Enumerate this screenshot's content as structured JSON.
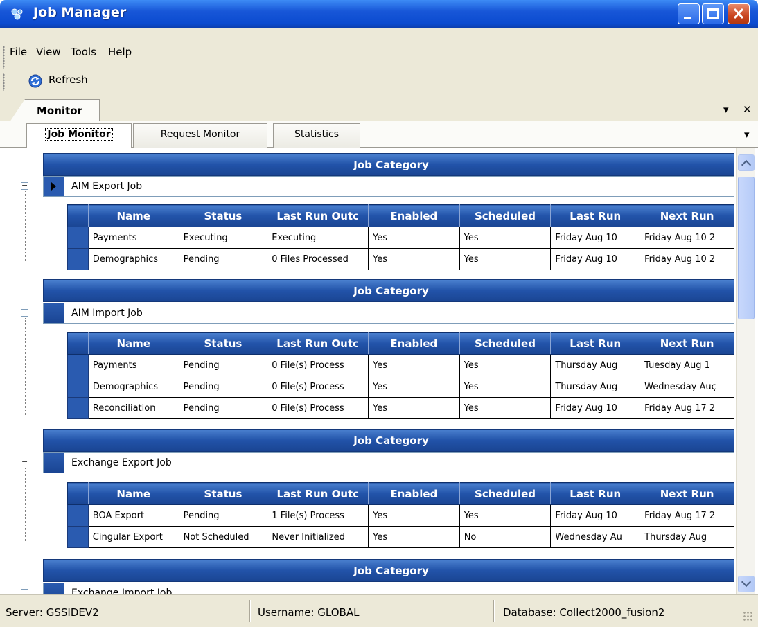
{
  "window": {
    "title": "Job Manager"
  },
  "menu": {
    "file": "File",
    "view": "View",
    "tools": "Tools",
    "help": "Help"
  },
  "toolbar": {
    "refresh": "Refresh"
  },
  "panel": {
    "title": "Monitor",
    "pin": "▾",
    "close": "✕"
  },
  "tabs": [
    {
      "label": "Job Monitor"
    },
    {
      "label": "Request Monitor"
    },
    {
      "label": "Statistics"
    }
  ],
  "tabs_menu": "▾",
  "columns": [
    "Name",
    "Status",
    "Last Run Outc",
    "Enabled",
    "Scheduled",
    "Last Run",
    "Next Run"
  ],
  "categories": [
    {
      "header": "Job Category",
      "name": "AIM Export Job",
      "rows": [
        [
          "Payments",
          "Executing",
          "Executing",
          "Yes",
          "Yes",
          "Friday Aug 10",
          "Friday Aug 10 2"
        ],
        [
          "Demographics",
          "Pending",
          "0 Files Processed",
          "Yes",
          "Yes",
          "Friday Aug 10",
          "Friday Aug 10 2"
        ]
      ]
    },
    {
      "header": "Job Category",
      "name": "AIM Import Job",
      "rows": [
        [
          "Payments",
          "Pending",
          "0 File(s) Process",
          "Yes",
          "Yes",
          "Thursday Aug",
          "Tuesday Aug 1"
        ],
        [
          "Demographics",
          "Pending",
          "0 File(s) Process",
          "Yes",
          "Yes",
          "Thursday Aug",
          "Wednesday Auç"
        ],
        [
          "Reconciliation",
          "Pending",
          "0 File(s) Process",
          "Yes",
          "Yes",
          "Friday Aug 10",
          "Friday Aug 17 2"
        ]
      ]
    },
    {
      "header": "Job Category",
      "name": "Exchange Export Job",
      "rows": [
        [
          "BOA Export",
          "Pending",
          "1 File(s) Process",
          "Yes",
          "Yes",
          "Friday Aug 10",
          "Friday Aug 17 2"
        ],
        [
          "Cingular Export",
          "Not Scheduled",
          "Never Initialized",
          "Yes",
          "No",
          "Wednesday Au",
          "Thursday Aug"
        ]
      ]
    },
    {
      "header": "Job Category",
      "name": "Exchange Import Job",
      "rows": []
    }
  ],
  "status": {
    "server": "Server: GSSIDEV2",
    "username": "Username: GLOBAL",
    "database": "Database: Collect2000_fusion2"
  }
}
